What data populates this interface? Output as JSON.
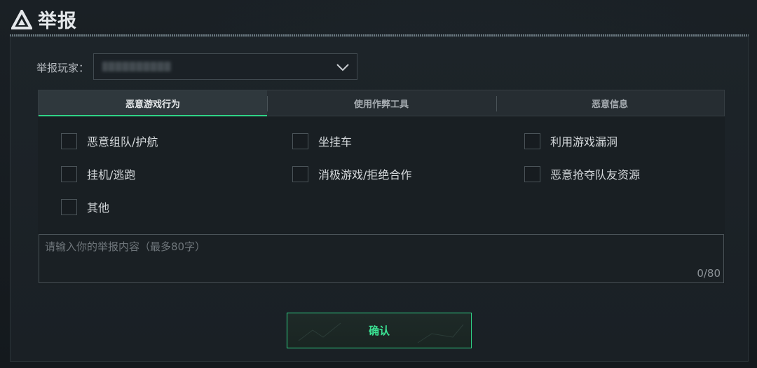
{
  "header": {
    "title": "举报",
    "logo_icon": "triangle-logo-icon"
  },
  "player": {
    "label": "举报玩家：",
    "value_blurred": true,
    "dropdown_icon": "chevron-down-icon"
  },
  "tabs": [
    {
      "label": "恶意游戏行为",
      "active": true
    },
    {
      "label": "使用作弊工具",
      "active": false
    },
    {
      "label": "恶意信息",
      "active": false
    }
  ],
  "options": [
    {
      "label": "恶意组队/护航",
      "checked": false
    },
    {
      "label": "坐挂车",
      "checked": false
    },
    {
      "label": "利用游戏漏洞",
      "checked": false
    },
    {
      "label": "挂机/逃跑",
      "checked": false
    },
    {
      "label": "消极游戏/拒绝合作",
      "checked": false
    },
    {
      "label": "恶意抢夺队友资源",
      "checked": false
    },
    {
      "label": "其他",
      "checked": false
    }
  ],
  "report_text": {
    "placeholder": "请输入你的举报内容（最多80字）",
    "value": "",
    "counter": "0/80"
  },
  "confirm_label": "确认",
  "colors": {
    "accent": "#2fd487",
    "background": "#151a1f"
  }
}
